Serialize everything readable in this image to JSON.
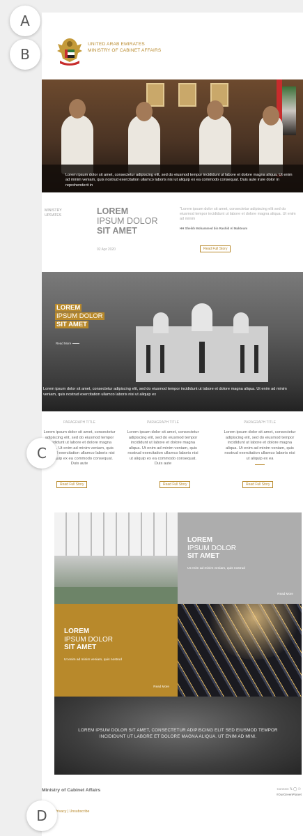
{
  "annotations": {
    "a": "A",
    "b": "B",
    "c": "C",
    "d": "D"
  },
  "header": {
    "org_line1": "UNITED ARAB EMIRATES",
    "org_line2": "MINISTRY OF CABINET AFFAIRS",
    "logo_icon": "uae-emblem-icon"
  },
  "hero": {
    "caption": "Lorem ipsum dolor sit amet, consectetur adipiscing elit, sed do eiusmod tempor incididunt ut labore et dolore magna aliqua. Ut enim ad  minim veniam, quis nostrud exercitation ullamco laboris nisi ut aliquip ex ea commodo consequat. Duis aute irure dolor in reprehenderit in"
  },
  "updates": {
    "label_line1": "MINISTRY",
    "label_line2": "UPDATES",
    "title_line1": "LOREM",
    "title_line2": "IPSUM DOLOR",
    "title_line3": "SIT AMET",
    "date": "02 Apr 2020",
    "quote": "\"Lorem ipsum dolor sit amet, consectetur adipiscing elit sed do eiusmod tempor incididunt ut labore et dolore magna aliqua. Ut enim ad minim",
    "author": "HH Sheikh Mohammed bin Rashid Al Maktoum",
    "read_full": "Read Full Story"
  },
  "feature": {
    "title_line1": "LOREM",
    "title_line2": "IPSUM DOLOR",
    "title_line3": "SIT AMET",
    "read_more": "Read More",
    "caption": "Lorem ipsum dolor sit amet, consectetur adipiscing elit, sed do eiusmod tempor incididunt ut labore et dolore magna aliqua. Ut enim ad  minim veniam, quis nostrud exercitation ullamco laboris nisi ut aliquip ex"
  },
  "columns": [
    {
      "title": "PARAGRAPH TITLE",
      "body": "Lorem ipsum dolor sit amet, consectetur adipiscing elit, sed do eiusmod tempor incididunt ut labore et dolore magna aliqua. Ut enim ad minim veniam, quis nostrud exercitation ullamco laboris nisi ut aliquip ex ea commodo consequat. Duis aute",
      "button": "Read Full Story"
    },
    {
      "title": "PARAGRAPH TITLE",
      "body": "Lorem ipsum dolor sit amet, consectetur adipiscing elit, sed do eiusmod tempor incididunt ut labore et dolore magna aliqua. Ut enim ad minim veniam, quis nostrud exercitation ullamco laboris nisi ut aliquip ex ea commodo consequat. Duis aute",
      "button": "Read Full Story"
    },
    {
      "title": "PARAGRAPH TITLE",
      "body": "Lorem ipsum dolor sit amet, consectetur adipiscing elit, sed do eiusmod tempor incididunt ut labore et dolore magna aliqua. Ut enim ad minim veniam, quis nostrud exercitation ullamco laboris nisi ut aliquip ex ea",
      "button": "Read Full Story"
    }
  ],
  "tiles": {
    "grey": {
      "title_line1": "LOREM",
      "title_line2": "IPSUM DOLOR",
      "title_line3": "SIT AMET",
      "subtitle": "Ut enim ad minim veniam, quis nostrud",
      "read_more": "Read More"
    },
    "gold": {
      "title_line1": "LOREM",
      "title_line2": "IPSUM DOLOR",
      "title_line3": "SIT AMET",
      "subtitle": "Ut enim ad minim veniam, quis nostrud",
      "read_more": "Read More"
    },
    "banner": "LOREM IPSUM DOLOR SIT AMET, CONSECTETUR ADIPISCING ELIT SED  EIUSMOD TEMPOR INCIDIDUNT UT LABORE ET DOLORE MAGNA ALIQUA. UT ENIM AD MINI."
  },
  "footer": {
    "ministry": "Ministry of Cabinet Affairs",
    "connect": "Connect",
    "social_icons": [
      "twitter-icon",
      "instagram-icon",
      "facebook-icon"
    ],
    "hashtag": "#OurGreenPlanet",
    "links": "Terms | Privacy | Unsubscribe"
  },
  "colors": {
    "gold": "#b8892b",
    "grey_tile": "#adadad",
    "page_bg": "#efefef"
  }
}
